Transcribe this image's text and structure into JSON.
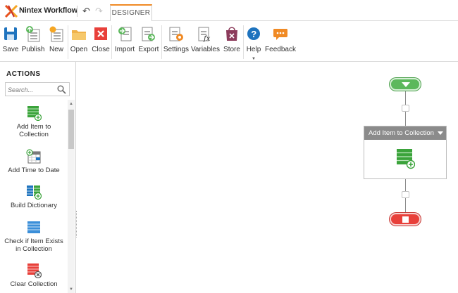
{
  "app": {
    "name": "Nintex Workflow"
  },
  "titlebar": {
    "tab_label": "DESIGNER"
  },
  "ribbon": {
    "buttons": [
      {
        "id": "save",
        "label": "Save",
        "icon": "save-icon"
      },
      {
        "id": "publish",
        "label": "Publish",
        "icon": "publish-icon"
      },
      {
        "id": "new",
        "label": "New",
        "icon": "new-icon"
      },
      {
        "id": "open",
        "label": "Open",
        "icon": "folder-icon"
      },
      {
        "id": "close",
        "label": "Close",
        "icon": "close-icon"
      },
      {
        "id": "import",
        "label": "Import",
        "icon": "import-icon"
      },
      {
        "id": "export",
        "label": "Export",
        "icon": "export-icon"
      },
      {
        "id": "settings",
        "label": "Settings",
        "icon": "settings-icon"
      },
      {
        "id": "variables",
        "label": "Variables",
        "icon": "variables-icon"
      },
      {
        "id": "store",
        "label": "Store",
        "icon": "store-icon"
      },
      {
        "id": "help",
        "label": "Help",
        "icon": "help-icon"
      },
      {
        "id": "feedback",
        "label": "Feedback",
        "icon": "feedback-icon"
      }
    ]
  },
  "actions": {
    "title": "ACTIONS",
    "search_placeholder": "Search...",
    "items": [
      {
        "label": "Add Item to Collection",
        "icon": "add-item-to-collection-icon"
      },
      {
        "label": "Add Time to Date",
        "icon": "add-time-to-date-icon"
      },
      {
        "label": "Build Dictionary",
        "icon": "build-dictionary-icon"
      },
      {
        "label": "Check if Item Exists in Collection",
        "icon": "check-item-exists-icon"
      },
      {
        "label": "Clear Collection",
        "icon": "clear-collection-icon"
      }
    ]
  },
  "canvas": {
    "action_card": {
      "title": "Add Item to Collection",
      "icon": "add-item-to-collection-icon"
    }
  },
  "colors": {
    "accent_orange": "#f08a24",
    "start_green": "#5cb85c",
    "end_red": "#e8403a",
    "card_header_gray": "#8b8b8b",
    "icon_blue": "#1e73be"
  }
}
